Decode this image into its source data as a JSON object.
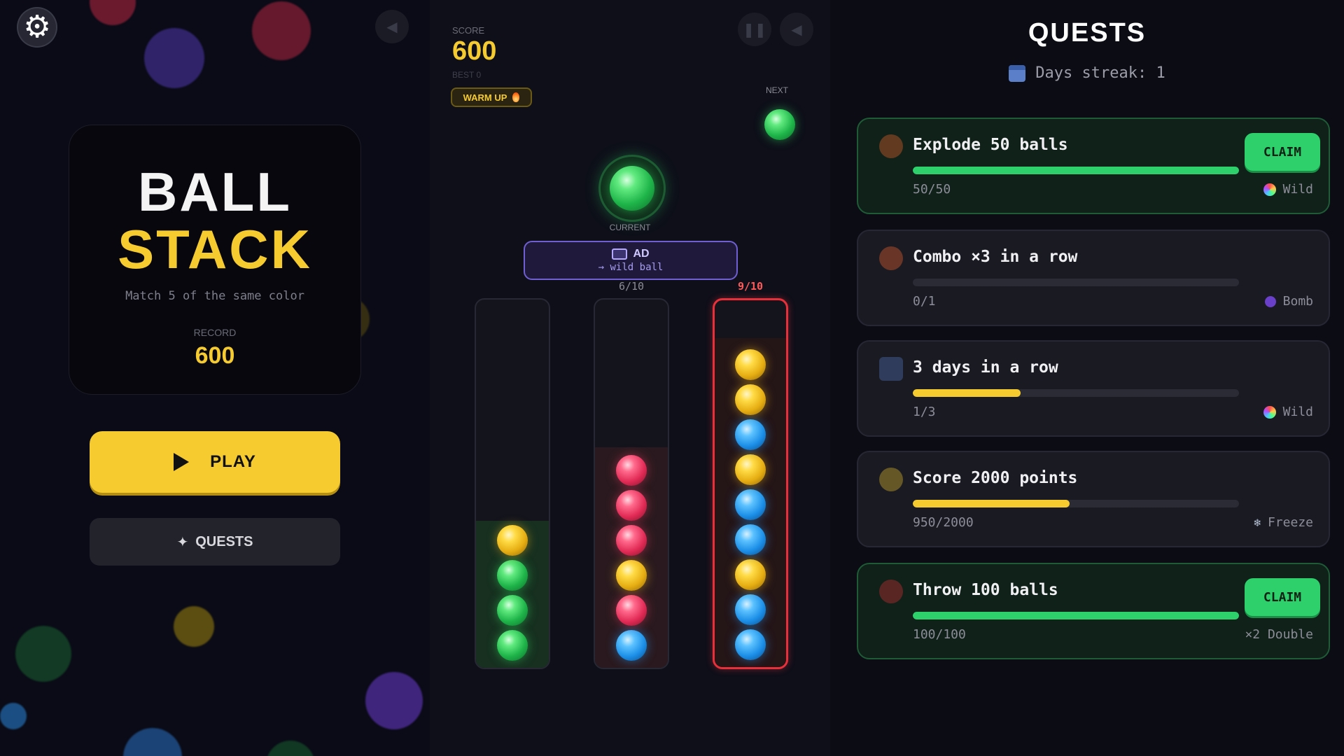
{
  "title_card": {
    "line1": "BALL",
    "line2": "STACK",
    "subtitle": "Match 5 of the same color",
    "record_label": "RECORD",
    "record_value": "600"
  },
  "menu": {
    "play_label": "PLAY",
    "quests_label": "QUESTS"
  },
  "hud": {
    "score_label": "SCORE",
    "score_value": "600",
    "best_label": "BEST 0",
    "warm_up_label": "WARM UP",
    "next_label": "NEXT",
    "current_label": "CURRENT",
    "next_ball_color": "green",
    "current_ball_color": "green"
  },
  "ad": {
    "label": "AD",
    "sub": "→ wild ball"
  },
  "tubes": [
    {
      "count": "",
      "balls": [
        "green",
        "green",
        "green",
        "yellow"
      ],
      "full": false
    },
    {
      "count": "6/10",
      "balls": [
        "blue",
        "pink",
        "yellow",
        "pink",
        "pink",
        "pink"
      ],
      "full": false
    },
    {
      "count": "9/10",
      "balls": [
        "blue",
        "blue",
        "yellow",
        "blue",
        "blue",
        "yellow",
        "blue",
        "yellow",
        "yellow"
      ],
      "full": true
    }
  ],
  "quests_panel": {
    "title": "QUESTS",
    "streak": "Days streak: 1",
    "claim_label": "CLAIM",
    "quests": [
      {
        "title": "Explode 50 balls",
        "progress": "50/50",
        "fraction": 1.0,
        "reward": "Wild",
        "reward_icon": "rainbow-icon",
        "claimable": true,
        "bar_color": "#2ed06c"
      },
      {
        "title": "Combo ×3 in a row",
        "progress": "0/1",
        "fraction": 0.0,
        "reward": "Bomb",
        "reward_icon": "bomb-icon",
        "claimable": false,
        "bar_color": "#f6cb2f"
      },
      {
        "title": "3 days in a row",
        "progress": "1/3",
        "fraction": 0.333,
        "reward": "Wild",
        "reward_icon": "rainbow-icon",
        "claimable": false,
        "bar_color": "#f6cb2f"
      },
      {
        "title": "Score 2000 points",
        "progress": "950/2000",
        "fraction": 0.475,
        "reward": "Freeze",
        "reward_icon": "snowflake-icon",
        "claimable": false,
        "bar_color": "#f6cb2f"
      },
      {
        "title": "Throw 100 balls",
        "progress": "100/100",
        "fraction": 1.0,
        "reward": "×2 Double",
        "reward_icon": "",
        "claimable": true,
        "bar_color": "#2ed06c"
      }
    ]
  },
  "colors": {
    "accent": "#f6cb2f",
    "green": "#2ed06c",
    "alert": "#e8303a",
    "ad": "#6f5fd2"
  }
}
